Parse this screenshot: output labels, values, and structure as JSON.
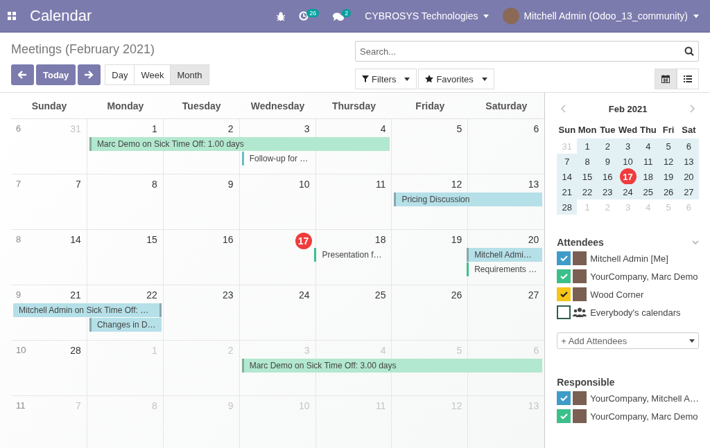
{
  "navbar": {
    "app_title": "Calendar",
    "activity_count": "26",
    "message_count": "2",
    "company": "CYBROSYS Technologies",
    "user": "Mitchell Admin (Odoo_13_community)"
  },
  "control_panel": {
    "breadcrumb": "Meetings (February 2021)",
    "today_button": "Today",
    "scale_buttons": [
      {
        "label": "Day",
        "selected": false
      },
      {
        "label": "Week",
        "selected": false
      },
      {
        "label": "Month",
        "selected": true
      }
    ],
    "search": {
      "placeholder": "Search..."
    },
    "filters_button": "Filters",
    "favorites_button": "Favorites",
    "views": [
      {
        "kind": "calendar",
        "selected": true
      },
      {
        "kind": "list",
        "selected": false
      }
    ]
  },
  "calendar": {
    "weekdays": [
      "Sunday",
      "Monday",
      "Tuesday",
      "Wednesday",
      "Thursday",
      "Friday",
      "Saturday"
    ],
    "weeks": [
      {
        "number": "6",
        "days": [
          {
            "day": "31",
            "muted": true,
            "today": false
          },
          {
            "day": "1",
            "muted": false,
            "today": false,
            "events": [
              {
                "kind": "allday",
                "title": "Marc Demo on Sick Time Off: 1.00 days",
                "color": "#b2e8cf",
                "accent_right": false
              }
            ]
          },
          {
            "day": "2",
            "muted": false,
            "today": false,
            "events": [
              {
                "kind": "continuation"
              }
            ]
          },
          {
            "day": "3",
            "muted": false,
            "today": false,
            "events": [
              {
                "kind": "continuation"
              },
              {
                "kind": "timed",
                "title": "Follow-up for …",
                "color": "#6bbdc8",
                "accent_right": false
              }
            ]
          },
          {
            "day": "4",
            "muted": false,
            "today": false,
            "events": [
              {
                "kind": "continuation"
              }
            ]
          },
          {
            "day": "5",
            "muted": false,
            "today": false
          },
          {
            "day": "6",
            "muted": false,
            "today": false
          }
        ]
      },
      {
        "number": "7",
        "days": [
          {
            "day": "7",
            "muted": false,
            "today": false
          },
          {
            "day": "8",
            "muted": false,
            "today": false
          },
          {
            "day": "9",
            "muted": false,
            "today": false
          },
          {
            "day": "10",
            "muted": false,
            "today": false
          },
          {
            "day": "11",
            "muted": false,
            "today": false
          },
          {
            "day": "12",
            "muted": false,
            "today": false,
            "events": [
              {
                "kind": "allday",
                "title": "Pricing Discussion",
                "color": "#b5e0e8",
                "accent_right": false
              }
            ]
          },
          {
            "day": "13",
            "muted": false,
            "today": false,
            "events": [
              {
                "kind": "continuation"
              }
            ]
          }
        ]
      },
      {
        "number": "8",
        "days": [
          {
            "day": "14",
            "muted": false,
            "today": false
          },
          {
            "day": "15",
            "muted": false,
            "today": false
          },
          {
            "day": "16",
            "muted": false,
            "today": false
          },
          {
            "day": "17",
            "muted": false,
            "today": true
          },
          {
            "day": "18",
            "muted": false,
            "today": false,
            "events": [
              {
                "kind": "timed",
                "title": "Presentation f…",
                "color": "#3cc08a",
                "accent_right": false
              }
            ]
          },
          {
            "day": "19",
            "muted": false,
            "today": false
          },
          {
            "day": "20",
            "muted": false,
            "today": false,
            "events": [
              {
                "kind": "allday",
                "title": "Mitchell Admi…",
                "color": "#b5e0e8",
                "accent_right": false
              },
              {
                "kind": "timed",
                "title": "Requirements …",
                "color": "#3cc08a",
                "accent_right": false
              }
            ]
          }
        ]
      },
      {
        "number": "9",
        "days": [
          {
            "day": "21",
            "muted": false,
            "today": false,
            "events": [
              {
                "kind": "allday",
                "title": "Mitchell Admin on Sick Time Off: …",
                "color": "#b5e0e8",
                "accent_right": true
              }
            ]
          },
          {
            "day": "22",
            "muted": false,
            "today": false,
            "events": [
              {
                "kind": "continuation"
              },
              {
                "kind": "allday",
                "title": "Changes in D…",
                "color": "#b5e0e8",
                "accent_right": false
              }
            ]
          },
          {
            "day": "23",
            "muted": false,
            "today": false
          },
          {
            "day": "24",
            "muted": false,
            "today": false
          },
          {
            "day": "25",
            "muted": false,
            "today": false
          },
          {
            "day": "26",
            "muted": false,
            "today": false
          },
          {
            "day": "27",
            "muted": false,
            "today": false
          }
        ]
      },
      {
        "number": "10",
        "days": [
          {
            "day": "28",
            "muted": false,
            "today": false
          },
          {
            "day": "1",
            "muted": true,
            "today": false
          },
          {
            "day": "2",
            "muted": true,
            "today": false
          },
          {
            "day": "3",
            "muted": true,
            "today": false,
            "events": [
              {
                "kind": "allday",
                "title": "Marc Demo on Sick Time Off: 3.00 days",
                "color": "#b2e8cf",
                "accent_right": false
              }
            ]
          },
          {
            "day": "4",
            "muted": true,
            "today": false,
            "events": [
              {
                "kind": "continuation"
              }
            ]
          },
          {
            "day": "5",
            "muted": true,
            "today": false,
            "events": [
              {
                "kind": "continuation"
              }
            ]
          },
          {
            "day": "6",
            "muted": true,
            "today": false,
            "events": [
              {
                "kind": "continuation"
              }
            ]
          }
        ]
      },
      {
        "number": "11",
        "days": [
          {
            "day": "7",
            "muted": true,
            "today": false
          },
          {
            "day": "8",
            "muted": true,
            "today": false
          },
          {
            "day": "9",
            "muted": true,
            "today": false
          },
          {
            "day": "10",
            "muted": true,
            "today": false
          },
          {
            "day": "11",
            "muted": true,
            "today": false
          },
          {
            "day": "12",
            "muted": true,
            "today": false
          },
          {
            "day": "13",
            "muted": true,
            "today": false
          }
        ]
      }
    ]
  },
  "sidebar": {
    "mini_calendar": {
      "title": "Feb 2021",
      "weekdays": [
        "Sun",
        "Mon",
        "Tue",
        "Wed",
        "Thu",
        "Fri",
        "Sat"
      ],
      "weeks": [
        [
          {
            "day": "31",
            "muted": true,
            "today": false
          },
          {
            "day": "1",
            "muted": false,
            "today": false
          },
          {
            "day": "2",
            "muted": false,
            "today": false
          },
          {
            "day": "3",
            "muted": false,
            "today": false
          },
          {
            "day": "4",
            "muted": false,
            "today": false
          },
          {
            "day": "5",
            "muted": false,
            "today": false
          },
          {
            "day": "6",
            "muted": false,
            "today": false
          }
        ],
        [
          {
            "day": "7",
            "muted": false,
            "today": false
          },
          {
            "day": "8",
            "muted": false,
            "today": false
          },
          {
            "day": "9",
            "muted": false,
            "today": false
          },
          {
            "day": "10",
            "muted": false,
            "today": false
          },
          {
            "day": "11",
            "muted": false,
            "today": false
          },
          {
            "day": "12",
            "muted": false,
            "today": false
          },
          {
            "day": "13",
            "muted": false,
            "today": false
          }
        ],
        [
          {
            "day": "14",
            "muted": false,
            "today": false
          },
          {
            "day": "15",
            "muted": false,
            "today": false
          },
          {
            "day": "16",
            "muted": false,
            "today": false
          },
          {
            "day": "17",
            "muted": false,
            "today": true
          },
          {
            "day": "18",
            "muted": false,
            "today": false
          },
          {
            "day": "19",
            "muted": false,
            "today": false
          },
          {
            "day": "20",
            "muted": false,
            "today": false
          }
        ],
        [
          {
            "day": "21",
            "muted": false,
            "today": false
          },
          {
            "day": "22",
            "muted": false,
            "today": false
          },
          {
            "day": "23",
            "muted": false,
            "today": false
          },
          {
            "day": "24",
            "muted": false,
            "today": false
          },
          {
            "day": "25",
            "muted": false,
            "today": false
          },
          {
            "day": "26",
            "muted": false,
            "today": false
          },
          {
            "day": "27",
            "muted": false,
            "today": false
          }
        ],
        [
          {
            "day": "28",
            "muted": false,
            "today": false
          },
          {
            "day": "1",
            "muted": true,
            "today": false
          },
          {
            "day": "2",
            "muted": true,
            "today": false
          },
          {
            "day": "3",
            "muted": true,
            "today": false
          },
          {
            "day": "4",
            "muted": true,
            "today": false
          },
          {
            "day": "5",
            "muted": true,
            "today": false
          },
          {
            "day": "6",
            "muted": true,
            "today": false
          }
        ]
      ]
    },
    "filters": [
      {
        "title": "Attendees",
        "items": [
          {
            "label": "Mitchell Admin [Me]",
            "kind": "person",
            "checked": true,
            "color": "#3f9cc8"
          },
          {
            "label": "YourCompany, Marc Demo",
            "kind": "person",
            "checked": true,
            "color": "#3cc08a"
          },
          {
            "label": "Wood Corner",
            "kind": "person",
            "checked": true,
            "color": "#f5c518"
          },
          {
            "label": "Everybody's calendars",
            "kind": "everybody",
            "checked": false,
            "color": "#2f5d50"
          }
        ],
        "add_placeholder": "+ Add Attendees"
      },
      {
        "title": "Responsible",
        "items": [
          {
            "label": "YourCompany, Mitchell A…",
            "kind": "person",
            "checked": true,
            "color": "#3f9cc8"
          },
          {
            "label": "YourCompany, Marc Demo",
            "kind": "person",
            "checked": true,
            "color": "#3cc08a"
          }
        ]
      }
    ]
  }
}
